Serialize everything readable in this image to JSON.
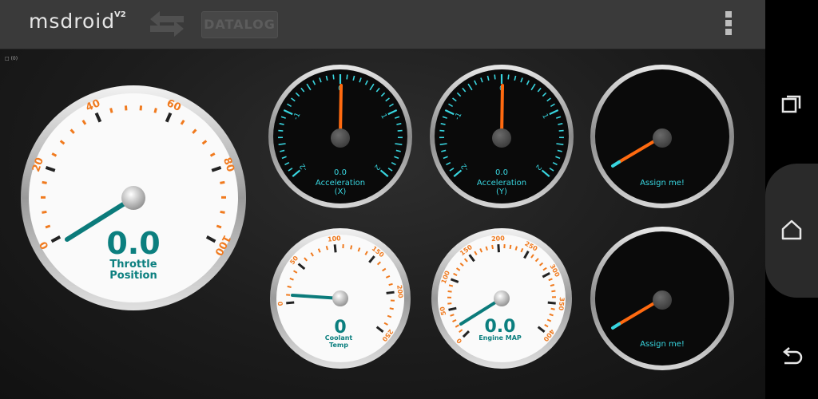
{
  "app": {
    "logo": "msdroid",
    "version": "V2",
    "datalog_label": "DATALOG",
    "indicator": "□ (0)"
  },
  "icons": {
    "sync": "sync-arrows-icon",
    "overflow": "overflow-menu-icon",
    "recents": "recent-apps-icon",
    "home": "home-icon",
    "back": "back-icon"
  },
  "colors": {
    "accent_teal": "#0b8a8a",
    "accent_orange": "#ff7a1a",
    "cyan_tick": "#38d6e0",
    "actionbar": "#3a3a3a"
  },
  "gauges": {
    "throttle": {
      "value": "0.0",
      "label_line1": "Throttle",
      "label_line2": "Position",
      "ticks": [
        "0",
        "20",
        "40",
        "60",
        "80",
        "100"
      ]
    },
    "accel_x": {
      "value": "0.0",
      "label_line1": "Acceleration",
      "label_line2": "(X)",
      "ticks": [
        "-2",
        "-1",
        "0",
        "1",
        "2"
      ]
    },
    "accel_y": {
      "value": "0.0",
      "label_line1": "Acceleration",
      "label_line2": "(Y)",
      "ticks": [
        "-2",
        "-1",
        "0",
        "1",
        "2"
      ]
    },
    "assign1": {
      "label": "Assign me!"
    },
    "coolant": {
      "value": "0",
      "label_line1": "Coolant",
      "label_line2": "Temp",
      "ticks": [
        "0",
        "50",
        "100",
        "150",
        "200",
        "250"
      ]
    },
    "map": {
      "value": "0.0",
      "label_line1": "Engine MAP",
      "ticks": [
        "0",
        "50",
        "100",
        "150",
        "200",
        "250",
        "300",
        "350",
        "400"
      ]
    },
    "assign2": {
      "label": "Assign me!"
    }
  }
}
